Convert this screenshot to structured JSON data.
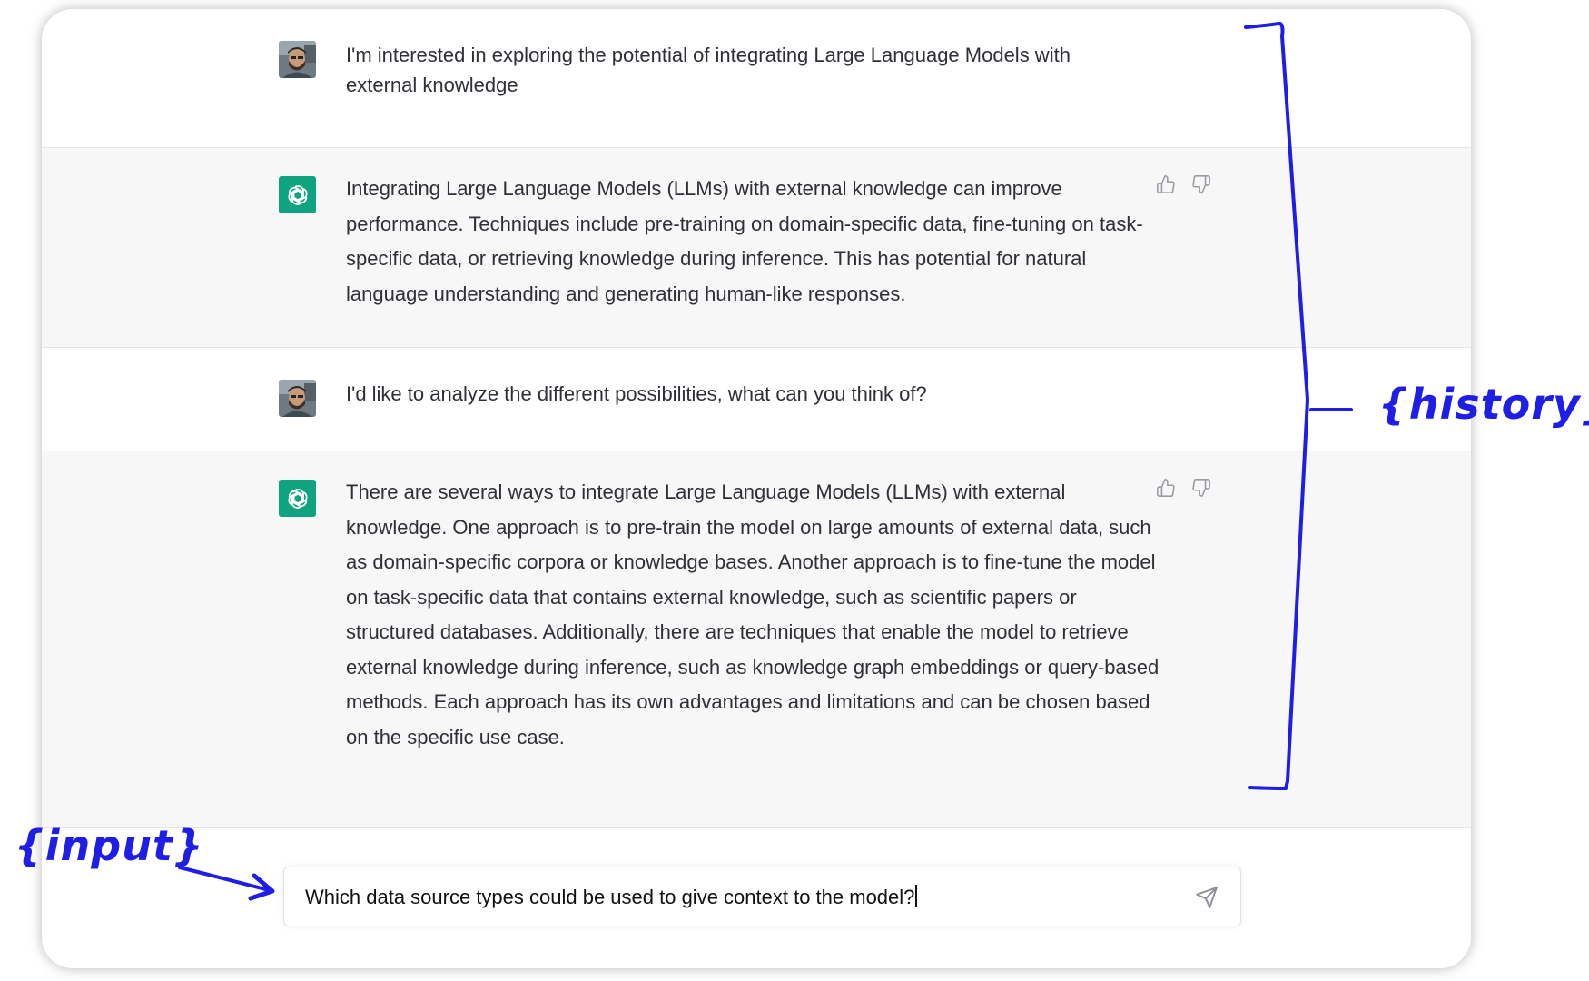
{
  "conversation": {
    "messages": [
      {
        "role": "user",
        "text": "I'm interested in exploring the potential of integrating Large Language Models with external knowledge"
      },
      {
        "role": "assistant",
        "text": "Integrating Large Language Models (LLMs) with external knowledge can improve performance. Techniques include pre-training on domain-specific data, fine-tuning on task-specific data, or retrieving knowledge during inference. This has potential for natural language understanding and generating human-like responses."
      },
      {
        "role": "user",
        "text": "I'd like to analyze the different possibilities, what can you think of?"
      },
      {
        "role": "assistant",
        "text": "There are several ways to integrate Large Language Models (LLMs) with external knowledge. One approach is to pre-train the model on large amounts of external data, such as domain-specific corpora or knowledge bases. Another approach is to fine-tune the model on task-specific data that contains external knowledge, such as scientific papers or structured databases. Additionally, there are techniques that enable the model to retrieve external knowledge during inference, such as knowledge graph embeddings or query-based methods. Each approach has its own advantages and limitations and can be chosen based on the specific use case."
      }
    ]
  },
  "input": {
    "value": "Which data source types could be used to give context to the model?"
  },
  "annotations": {
    "history_label": "{history}",
    "input_label": "{input}"
  },
  "icons": {
    "user_avatar": "user-photo-avatar",
    "assistant_avatar": "openai-logo-icon",
    "thumbs_up": "thumbs-up-icon",
    "thumbs_down": "thumbs-down-icon",
    "send": "paper-plane-send-icon"
  },
  "colors": {
    "assistant_bg": "#f7f7f8",
    "brand_green": "#10a37f",
    "annotation_blue": "#1e1ee6",
    "text": "#2f2f38"
  }
}
